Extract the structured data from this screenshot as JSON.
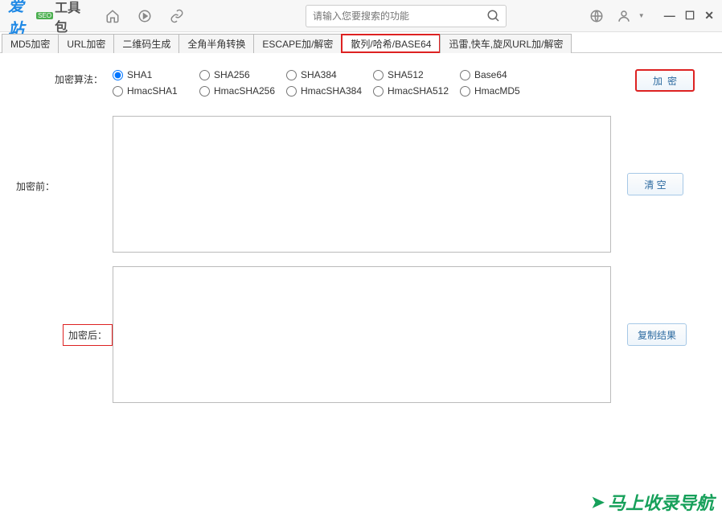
{
  "titlebar": {
    "logo_main": "爱站",
    "logo_badge": "SEO",
    "logo_sub": "工具包",
    "search_placeholder": "请输入您要搜索的功能"
  },
  "tabs": [
    {
      "label": "MD5加密",
      "active": false
    },
    {
      "label": "URL加密",
      "active": false
    },
    {
      "label": "二维码生成",
      "active": false
    },
    {
      "label": "全角半角转换",
      "active": false
    },
    {
      "label": "ESCAPE加/解密",
      "active": false
    },
    {
      "label": "散列/哈希/BASE64",
      "active": true
    },
    {
      "label": "迅雷,快车,旋风URL加/解密",
      "active": false
    }
  ],
  "labels": {
    "algorithm": "加密算法：",
    "before": "加密前：",
    "after": "加密后："
  },
  "algorithms_row1": [
    {
      "name": "SHA1",
      "checked": true
    },
    {
      "name": "SHA256",
      "checked": false
    },
    {
      "name": "SHA384",
      "checked": false
    },
    {
      "name": "SHA512",
      "checked": false
    },
    {
      "name": "Base64",
      "checked": false
    }
  ],
  "algorithms_row2": [
    {
      "name": "HmacSHA1",
      "checked": false
    },
    {
      "name": "HmacSHA256",
      "checked": false
    },
    {
      "name": "HmacSHA384",
      "checked": false
    },
    {
      "name": "HmacSHA512",
      "checked": false
    },
    {
      "name": "HmacMD5",
      "checked": false
    }
  ],
  "buttons": {
    "encrypt": "加密",
    "clear": "清 空",
    "copy": "复制结果"
  },
  "inputs": {
    "before_value": "",
    "after_value": ""
  },
  "footer": {
    "brand": "马上收录导航"
  }
}
